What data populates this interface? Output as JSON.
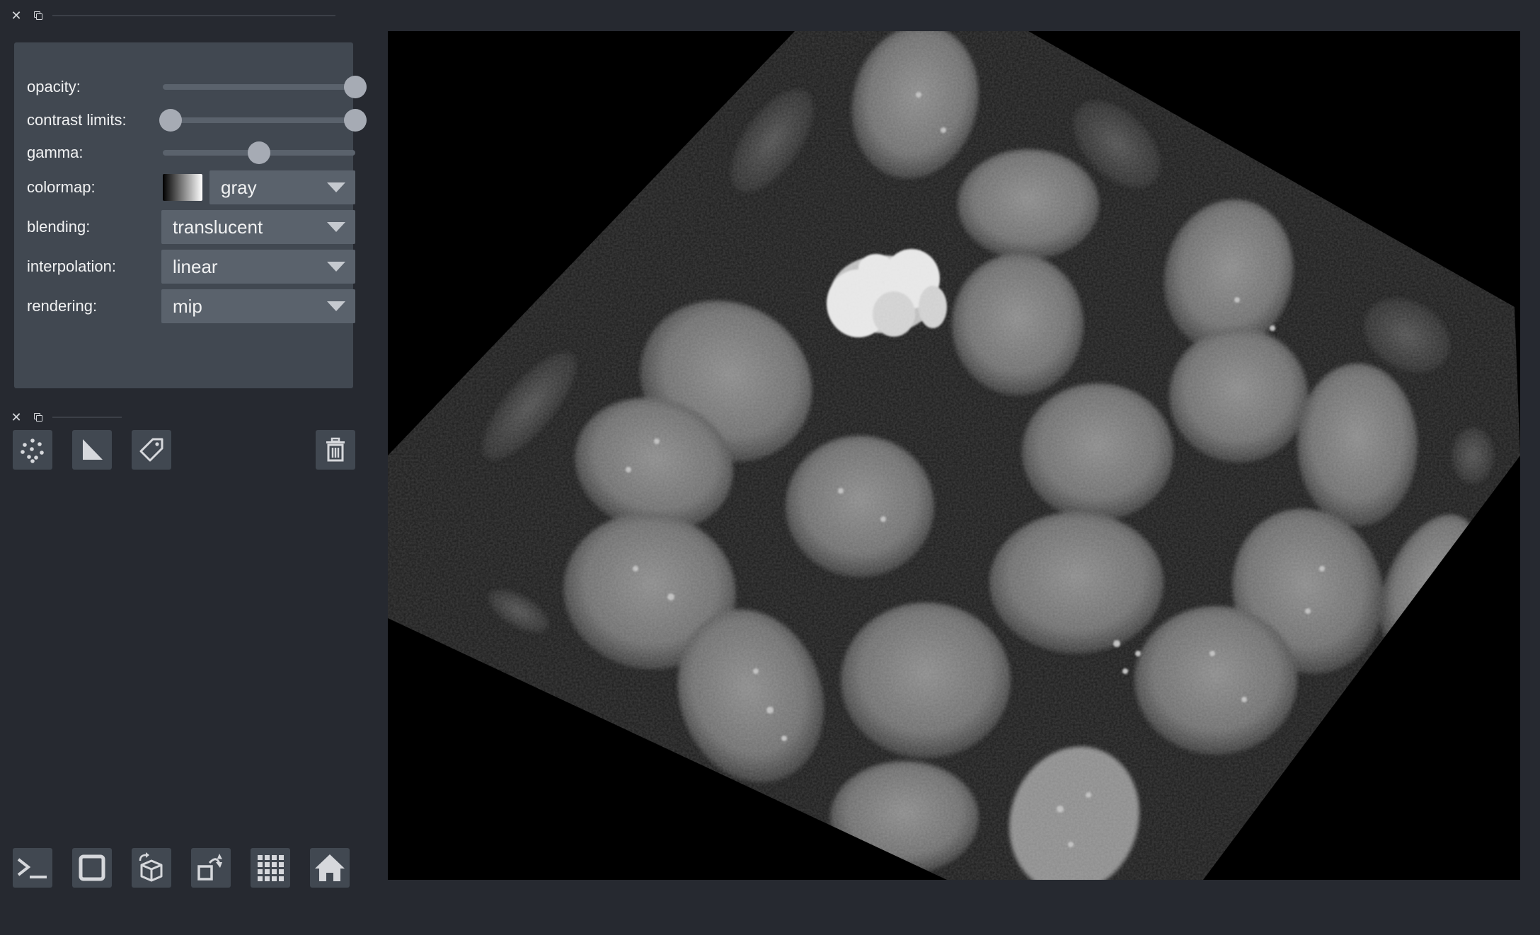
{
  "layer_controls": {
    "opacity_label": "opacity:",
    "opacity_value": 1.0,
    "contrast_limits_label": "contrast limits:",
    "contrast_limits_value": [
      0.0,
      1.0
    ],
    "gamma_label": "gamma:",
    "gamma_value": 0.5,
    "colormap_label": "colormap:",
    "colormap_value": "gray",
    "blending_label": "blending:",
    "blending_value": "translucent",
    "interpolation_label": "interpolation:",
    "interpolation_value": "linear",
    "rendering_label": "rendering:",
    "rendering_value": "mip"
  },
  "layer_buttons": {
    "icons": [
      "new-points-icon",
      "new-shapes-icon",
      "new-labels-icon",
      "delete-layer-icon"
    ]
  },
  "viewer_buttons": {
    "icons": [
      "console-icon",
      "ndisplay-toggle-icon",
      "roll-icon",
      "transpose-icon",
      "grid-view-icon",
      "home-icon"
    ]
  },
  "colors": {
    "background": "#262930",
    "panel": "#414851",
    "control": "#5a626c",
    "handle": "#a6abb4",
    "text": "#f0f1f2"
  }
}
